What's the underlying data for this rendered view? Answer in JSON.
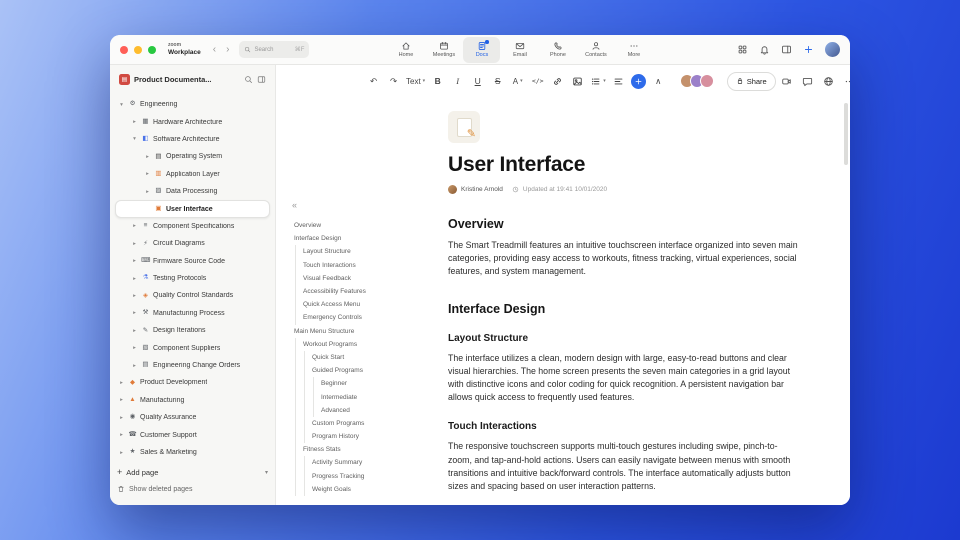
{
  "titlebar": {
    "logo_top": "zoom",
    "logo_bottom": "Workplace",
    "search_placeholder": "Search",
    "search_shortcut": "⌘F",
    "tabs": [
      {
        "label": "Home",
        "icon": "home",
        "active": false
      },
      {
        "label": "Meetings",
        "icon": "calendar",
        "active": false
      },
      {
        "label": "Docs",
        "icon": "doc",
        "active": true
      },
      {
        "label": "Email",
        "icon": "mail",
        "active": false
      },
      {
        "label": "Phone",
        "icon": "phone",
        "active": false
      },
      {
        "label": "Contacts",
        "icon": "person",
        "active": false
      },
      {
        "label": "More",
        "icon": "dots",
        "active": false
      }
    ]
  },
  "sidebar": {
    "workspace_title": "Product Documenta...",
    "add_page_label": "Add page",
    "show_deleted_label": "Show deleted pages",
    "tree": [
      {
        "label": "Engineering",
        "icon": "gear",
        "color": "#5f6368",
        "level": 0,
        "chevron": "down",
        "selected": false
      },
      {
        "label": "Hardware Architecture",
        "icon": "chip",
        "color": "#5f6368",
        "level": 1,
        "chevron": "right",
        "selected": false
      },
      {
        "label": "Software Architecture",
        "icon": "layers",
        "color": "#4a72e8",
        "level": 1,
        "chevron": "down",
        "selected": false
      },
      {
        "label": "Operating System",
        "icon": "terminal",
        "color": "#474747",
        "level": 2,
        "chevron": "right",
        "selected": false
      },
      {
        "label": "Application Layer",
        "icon": "box",
        "color": "#e07b39",
        "level": 2,
        "chevron": "right",
        "selected": false
      },
      {
        "label": "Data Processing",
        "icon": "chart",
        "color": "#5f6368",
        "level": 2,
        "chevron": "right",
        "selected": false
      },
      {
        "label": "User Interface",
        "icon": "screen",
        "color": "#e07b39",
        "level": 2,
        "chevron": "none",
        "selected": true
      },
      {
        "label": "Component Specifications",
        "icon": "clipboard",
        "color": "#5f6368",
        "level": 1,
        "chevron": "right",
        "selected": false
      },
      {
        "label": "Circuit Diagrams",
        "icon": "bolt",
        "color": "#5f6368",
        "level": 1,
        "chevron": "right",
        "selected": false
      },
      {
        "label": "Firmware Source Code",
        "icon": "keyboard",
        "color": "#5f6368",
        "level": 1,
        "chevron": "right",
        "selected": false
      },
      {
        "label": "Testing Protocols",
        "icon": "flask",
        "color": "#4a72e8",
        "level": 1,
        "chevron": "right",
        "selected": false
      },
      {
        "label": "Quality Control Standards",
        "icon": "diamond-badge",
        "color": "#e07b39",
        "level": 1,
        "chevron": "right",
        "selected": false
      },
      {
        "label": "Manufacturing Process",
        "icon": "hammer",
        "color": "#5f6368",
        "level": 1,
        "chevron": "right",
        "selected": false
      },
      {
        "label": "Design Iterations",
        "icon": "pencil",
        "color": "#5f6368",
        "level": 1,
        "chevron": "right",
        "selected": false
      },
      {
        "label": "Component Suppliers",
        "icon": "package",
        "color": "#5f6368",
        "level": 1,
        "chevron": "right",
        "selected": false
      },
      {
        "label": "Engineering Change Orders",
        "icon": "document",
        "color": "#5f6368",
        "level": 1,
        "chevron": "right",
        "selected": false
      },
      {
        "label": "Product Development",
        "icon": "diamond",
        "color": "#e07b39",
        "level": 0,
        "chevron": "right",
        "selected": false
      },
      {
        "label": "Manufacturing",
        "icon": "triangle",
        "color": "#e07b39",
        "level": 0,
        "chevron": "right",
        "selected": false
      },
      {
        "label": "Quality Assurance",
        "icon": "target",
        "color": "#5f6368",
        "level": 0,
        "chevron": "right",
        "selected": false
      },
      {
        "label": "Customer Support",
        "icon": "phone-support",
        "color": "#5f6368",
        "level": 0,
        "chevron": "right",
        "selected": false
      },
      {
        "label": "Sales & Marketing",
        "icon": "star",
        "color": "#5f6368",
        "level": 0,
        "chevron": "right",
        "selected": false
      }
    ]
  },
  "outline": {
    "items": [
      {
        "label": "Overview",
        "level": 0
      },
      {
        "label": "Interface Design",
        "level": 0
      },
      {
        "label": "Layout Structure",
        "level": 1
      },
      {
        "label": "Touch Interactions",
        "level": 1
      },
      {
        "label": "Visual Feedback",
        "level": 1
      },
      {
        "label": "Accessibility Features",
        "level": 1
      },
      {
        "label": "Quick Access Menu",
        "level": 1
      },
      {
        "label": "Emergency Controls",
        "level": 1
      },
      {
        "label": "Main Menu Structure",
        "level": 0
      },
      {
        "label": "Workout Programs",
        "level": 1
      },
      {
        "label": "Quick Start",
        "level": 2
      },
      {
        "label": "Guided Programs",
        "level": 2
      },
      {
        "label": "Beginner",
        "level": 3
      },
      {
        "label": "Intermediate",
        "level": 3
      },
      {
        "label": "Advanced",
        "level": 3
      },
      {
        "label": "Custom Programs",
        "level": 2
      },
      {
        "label": "Program History",
        "level": 2
      },
      {
        "label": "Fitness Stats",
        "level": 1
      },
      {
        "label": "Activity Summary",
        "level": 2
      },
      {
        "label": "Progress Tracking",
        "level": 2
      },
      {
        "label": "Weight Goals",
        "level": 2
      }
    ]
  },
  "toolbar": {
    "share_label": "Share",
    "buttons": [
      {
        "name": "undo-button",
        "glyph": "↶"
      },
      {
        "name": "redo-button",
        "glyph": "↷"
      },
      {
        "name": "text-style-select",
        "label": "Text",
        "caret": true
      },
      {
        "name": "bold-button",
        "glyph": "B",
        "cls": "b"
      },
      {
        "name": "italic-button",
        "glyph": "I",
        "cls": "i"
      },
      {
        "name": "underline-button",
        "glyph": "U",
        "cls": "u"
      },
      {
        "name": "strikethrough-button",
        "glyph": "S",
        "cls": "s"
      },
      {
        "name": "text-color-select",
        "label": "A",
        "caret": true
      },
      {
        "name": "inline-code-button",
        "glyph": "</>",
        "cls": "code"
      },
      {
        "name": "link-button",
        "icon": "link"
      },
      {
        "name": "image-button",
        "icon": "image"
      },
      {
        "name": "list-button",
        "icon": "list",
        "caret": true
      },
      {
        "name": "align-button",
        "icon": "align"
      },
      {
        "name": "insert-button",
        "icon": "plus",
        "accent": true
      },
      {
        "name": "collapse-toolbar-button",
        "glyph": "∧"
      }
    ],
    "collaborators": [
      {
        "color": "#c4916c"
      },
      {
        "color": "#9b80c9"
      },
      {
        "color": "#d78f9e"
      }
    ]
  },
  "document": {
    "title": "User Interface",
    "author": "Kristine Arnold",
    "updated": "Updated at 19:41 10/01/2020",
    "blocks": [
      {
        "type": "h2",
        "text": "Overview"
      },
      {
        "type": "p",
        "text": "The Smart Treadmill features an intuitive touchscreen interface organized into seven main categories, providing easy access to workouts, fitness tracking, virtual experiences, social features, and system management."
      },
      {
        "type": "h2",
        "text": "Interface Design"
      },
      {
        "type": "h3",
        "text": "Layout Structure"
      },
      {
        "type": "p",
        "text": "The interface utilizes a clean, modern design with large, easy-to-read buttons and clear visual hierarchies. The home screen presents the seven main categories in a grid layout with distinctive icons and color coding for quick recognition. A persistent navigation bar allows quick access to frequently used features."
      },
      {
        "type": "h3",
        "text": "Touch Interactions"
      },
      {
        "type": "p",
        "text": "The responsive touchscreen supports multi-touch gestures including swipe, pinch-to-zoom, and tap-and-hold actions. Users can easily navigate between menus with smooth transitions and intuitive back/forward controls. The interface automatically adjusts button sizes and spacing based on user interaction patterns."
      }
    ]
  },
  "colors": {
    "accent_blue": "#2e6bea",
    "active_tab_blue": "#2160e4",
    "orange_icon": "#e07b39"
  }
}
